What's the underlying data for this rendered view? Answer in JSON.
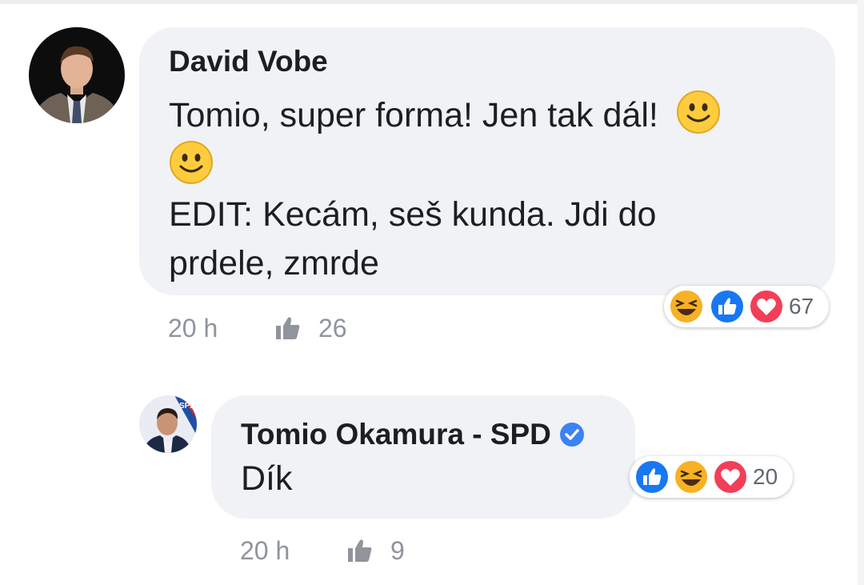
{
  "comments": [
    {
      "author": "David Vobe",
      "text_line1": "Tomio, super forma! Jen tak dál!",
      "text_line3": "EDIT: Kecám, seš kunda. Jdi do",
      "text_line4": "prdele, zmrde",
      "time": "20 h",
      "likes": "26",
      "reaction_count": "67",
      "reactions": [
        "haha-icon",
        "like-icon",
        "love-icon"
      ]
    },
    {
      "author": "Tomio Okamura - SPD",
      "verified": true,
      "text": "Dík",
      "time": "20 h",
      "likes": "9",
      "reaction_count": "20",
      "reactions": [
        "like-icon",
        "haha-icon",
        "love-icon"
      ]
    }
  ],
  "avatar_badge": "SPD",
  "colors": {
    "bubble": "#f1f2f6",
    "like_blue": "#1877f2",
    "love_red": "#f33e58",
    "haha_yellow": "#f7b125",
    "meta_gray": "#90949c"
  }
}
